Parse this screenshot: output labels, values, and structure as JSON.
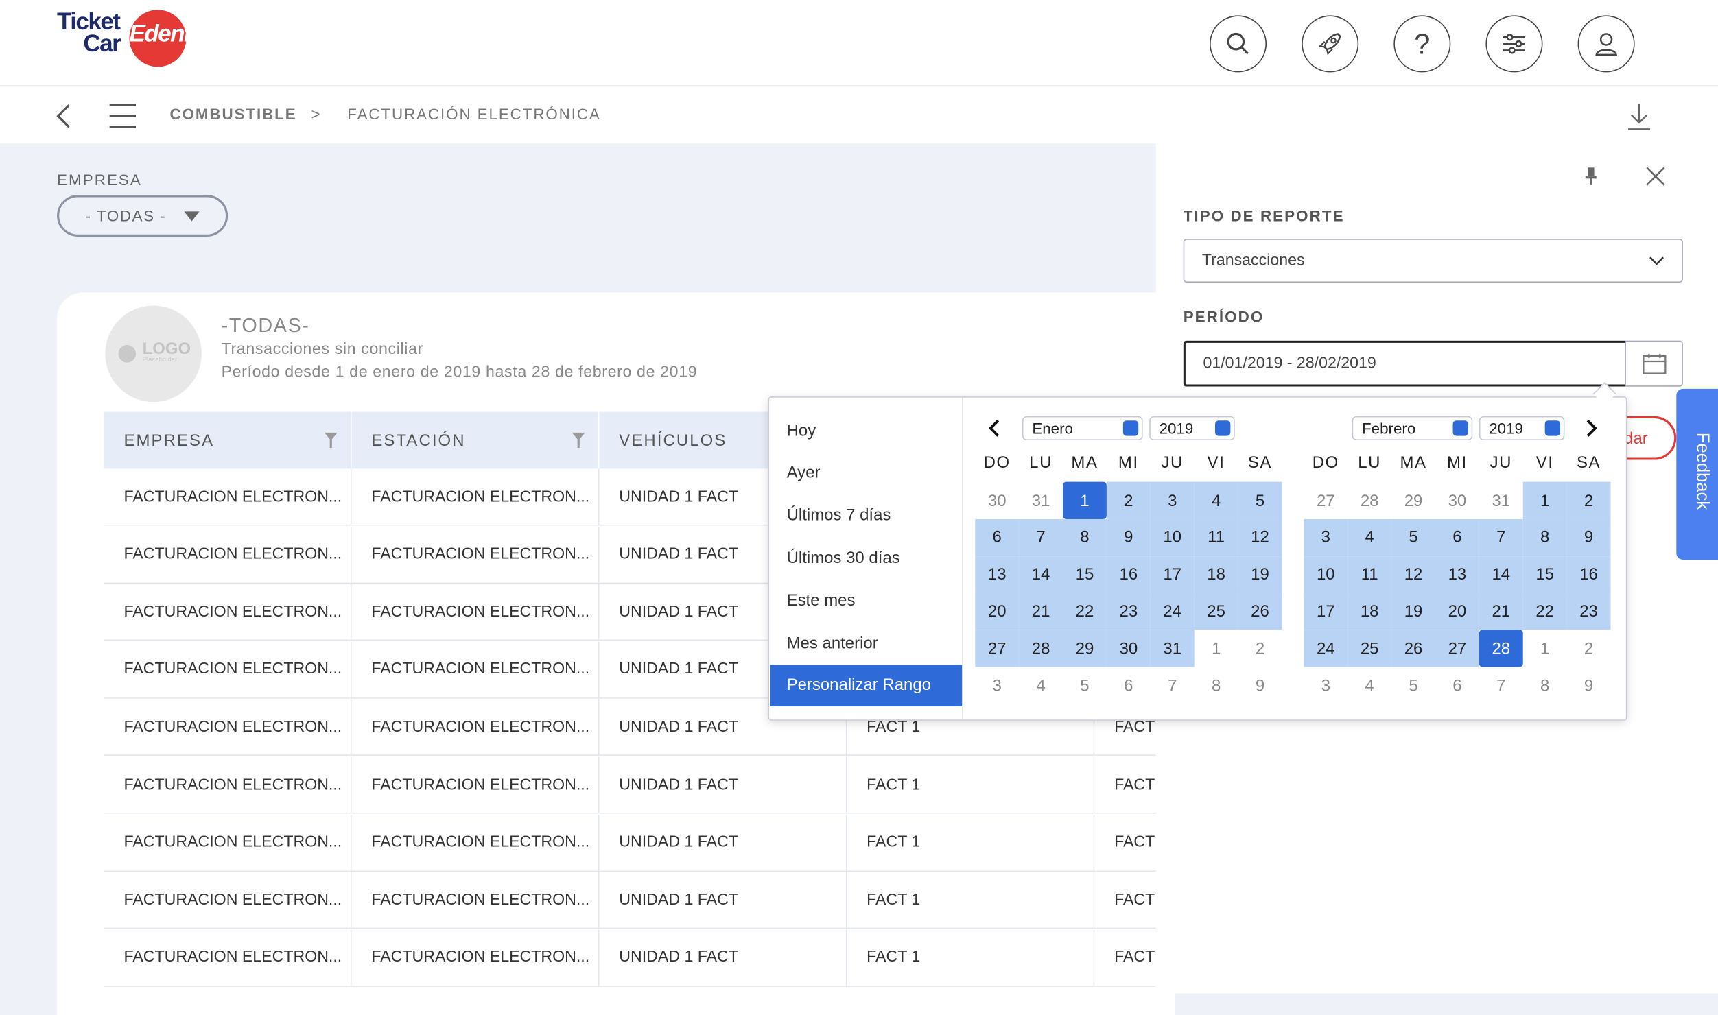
{
  "brand": {
    "line1": "Ticket",
    "line2": "Car",
    "edenred": "Edenred"
  },
  "header_icons": [
    "search-icon",
    "rocket-icon",
    "help-icon",
    "filters-icon",
    "user-icon"
  ],
  "breadcrumb": {
    "item1": "COMBUSTIBLE",
    "separator": ">",
    "item2": "FACTURACIÓN ELECTRÓNICA"
  },
  "filter": {
    "label": "EMPRESA",
    "value": "- TODAS -"
  },
  "card": {
    "logo_text": "LOGO",
    "logo_sub": "Placeholder",
    "title": "-TODAS-",
    "subtitle": "Transacciones sin conciliar",
    "period": "Período desde 1 de enero de 2019 hasta 28 de febrero de 2019"
  },
  "table": {
    "headers": [
      "EMPRESA",
      "ESTACIÓN",
      "VEHÍCULOS"
    ],
    "rows": [
      [
        "FACTURACION ELECTRON...",
        "FACTURACION ELECTRON...",
        "UNIDAD 1 FACT",
        "",
        ""
      ],
      [
        "FACTURACION ELECTRON...",
        "FACTURACION ELECTRON...",
        "UNIDAD 1 FACT",
        "",
        ""
      ],
      [
        "FACTURACION ELECTRON...",
        "FACTURACION ELECTRON...",
        "UNIDAD 1 FACT",
        "",
        ""
      ],
      [
        "FACTURACION ELECTRON...",
        "FACTURACION ELECTRON...",
        "UNIDAD 1 FACT",
        "",
        ""
      ],
      [
        "FACTURACION ELECTRON...",
        "FACTURACION ELECTRON...",
        "UNIDAD 1 FACT",
        "FACT 1",
        "FACT"
      ],
      [
        "FACTURACION ELECTRON...",
        "FACTURACION ELECTRON...",
        "UNIDAD 1 FACT",
        "FACT 1",
        "FACT"
      ],
      [
        "FACTURACION ELECTRON...",
        "FACTURACION ELECTRON...",
        "UNIDAD 1 FACT",
        "FACT 1",
        "FACT"
      ],
      [
        "FACTURACION ELECTRON...",
        "FACTURACION ELECTRON...",
        "UNIDAD 1 FACT",
        "FACT 1",
        "FACT"
      ],
      [
        "FACTURACION ELECTRON...",
        "FACTURACION ELECTRON...",
        "UNIDAD 1 FACT",
        "FACT 1",
        "FACT"
      ]
    ]
  },
  "panel": {
    "report_type_label": "TIPO DE REPORTE",
    "report_type_value": "Transacciones",
    "period_label": "PERÍODO",
    "period_value": "01/01/2019 - 28/02/2019",
    "partial_button": "dar"
  },
  "feedback": "Feedback",
  "picker": {
    "ranges": [
      "Hoy",
      "Ayer",
      "Últimos 7 días",
      "Últimos 30 días",
      "Este mes",
      "Mes anterior",
      "Personalizar Rango"
    ],
    "active_range": "Personalizar Rango",
    "weekdays": [
      "DO",
      "LU",
      "MA",
      "MI",
      "JU",
      "VI",
      "SA"
    ],
    "left": {
      "month": "Enero",
      "year": "2019",
      "weeks": [
        [
          "30",
          "31",
          "1",
          "2",
          "3",
          "4",
          "5"
        ],
        [
          "6",
          "7",
          "8",
          "9",
          "10",
          "11",
          "12"
        ],
        [
          "13",
          "14",
          "15",
          "16",
          "17",
          "18",
          "19"
        ],
        [
          "20",
          "21",
          "22",
          "23",
          "24",
          "25",
          "26"
        ],
        [
          "27",
          "28",
          "29",
          "30",
          "31",
          "1",
          "2"
        ],
        [
          "3",
          "4",
          "5",
          "6",
          "7",
          "8",
          "9"
        ]
      ]
    },
    "right": {
      "month": "Febrero",
      "year": "2019",
      "weeks": [
        [
          "27",
          "28",
          "29",
          "30",
          "31",
          "1",
          "2"
        ],
        [
          "3",
          "4",
          "5",
          "6",
          "7",
          "8",
          "9"
        ],
        [
          "10",
          "11",
          "12",
          "13",
          "14",
          "15",
          "16"
        ],
        [
          "17",
          "18",
          "19",
          "20",
          "21",
          "22",
          "23"
        ],
        [
          "24",
          "25",
          "26",
          "27",
          "28",
          "1",
          "2"
        ],
        [
          "3",
          "4",
          "5",
          "6",
          "7",
          "8",
          "9"
        ]
      ]
    },
    "range_start": "1",
    "range_end": "28"
  },
  "colors": {
    "accent": "#2f6bd8",
    "range_fill": "#b9d3f5",
    "brand_red": "#e53935",
    "feedback": "#4c7ff0"
  }
}
